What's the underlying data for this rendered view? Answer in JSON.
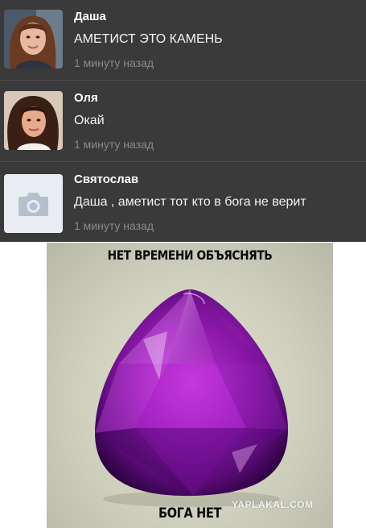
{
  "comments": [
    {
      "author": "Даша",
      "text": "АМЕТИСТ ЭТО КАМЕНЬ",
      "time": "1 минуту назад",
      "avatar": "photo-girl-long-hair"
    },
    {
      "author": "Оля",
      "text": "Окай",
      "time": "1 минуту назад",
      "avatar": "photo-girl-curly-hair"
    },
    {
      "author": "Святослав",
      "text": "Даша , аметист тот кто в бога не верит",
      "time": "1 минуту назад",
      "avatar": "camera-icon"
    }
  ],
  "meme": {
    "top_caption": "НЕТ ВРЕМЕНИ ОБЪЯСНЯТЬ",
    "bottom_caption": "БОГА НЕТ",
    "watermark": "YAPLAKAL.COM"
  },
  "colors": {
    "panel_background": "#3a3a3a",
    "divider": "#4e4e4e",
    "author_text": "#ffffff",
    "time_text": "#8a8a8a",
    "gem_purple": "#9a1fb8"
  }
}
